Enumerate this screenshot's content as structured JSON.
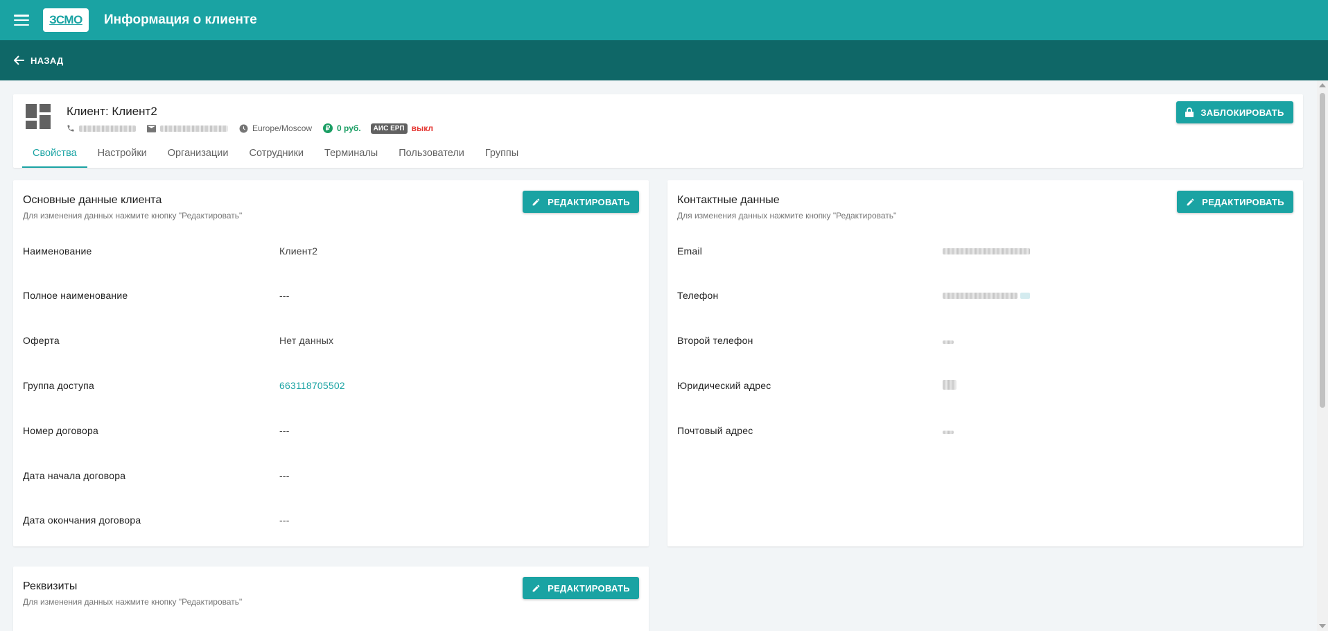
{
  "app": {
    "title": "Информация о клиенте",
    "logo_text": "ЗСМО",
    "back_label": "НАЗАД"
  },
  "client": {
    "title": "Клиент: Клиент2",
    "timezone": "Europe/Moscow",
    "balance": "0 руб.",
    "ais_badge": "АИС ЕРП",
    "ais_status": "выкл",
    "lock_label": "ЗАБЛОКИРОВАТЬ"
  },
  "tabs": [
    {
      "label": "Свойства"
    },
    {
      "label": "Настройки"
    },
    {
      "label": "Организации"
    },
    {
      "label": "Сотрудники"
    },
    {
      "label": "Терминалы"
    },
    {
      "label": "Пользователи"
    },
    {
      "label": "Группы"
    }
  ],
  "basic": {
    "title": "Основные данные клиента",
    "subtitle": "Для изменения данных нажмите кнопку \"Редактировать\"",
    "edit_label": "РЕДАКТИРОВАТЬ",
    "rows": [
      {
        "label": "Наименование",
        "value": "Клиент2"
      },
      {
        "label": "Полное наименование",
        "value": "---"
      },
      {
        "label": "Оферта",
        "value": "Нет данных"
      },
      {
        "label": "Группа доступа",
        "value": "663118705502"
      },
      {
        "label": "Номер договора",
        "value": "---"
      },
      {
        "label": "Дата начала договора",
        "value": "---"
      },
      {
        "label": "Дата окончания договора",
        "value": "---"
      }
    ]
  },
  "contact": {
    "title": "Контактные данные",
    "subtitle": "Для изменения данных нажмите кнопку \"Редактировать\"",
    "edit_label": "РЕДАКТИРОВАТЬ",
    "rows": [
      {
        "label": "Email"
      },
      {
        "label": "Телефон"
      },
      {
        "label": "Второй телефон"
      },
      {
        "label": "Юридический адрес"
      },
      {
        "label": "Почтовый адрес"
      }
    ]
  },
  "requisites": {
    "title": "Реквизиты",
    "subtitle": "Для изменения данных нажмите кнопку \"Редактировать\"",
    "edit_label": "РЕДАКТИРОВАТЬ"
  },
  "colors": {
    "primary": "#1aa3a3",
    "primary_dark": "#0f6767",
    "balance": "#1b9e64",
    "status_off": "#e53935"
  }
}
